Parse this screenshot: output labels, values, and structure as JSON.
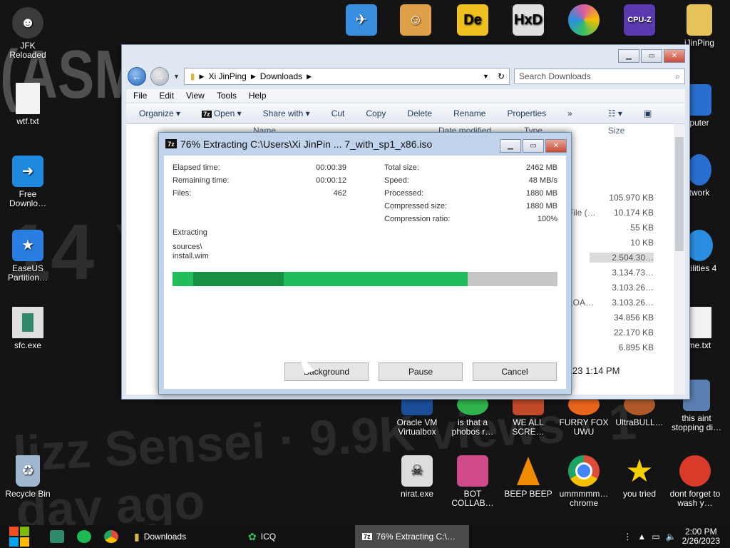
{
  "desktop": {
    "wallpaper_text": [
      "(ASMR)",
      "14 Year",
      "lizz Sensei · 9.9K views · 1 day ago"
    ],
    "icons": [
      {
        "label": "JFK Reloaded",
        "icon": "person-icon",
        "color": "#3b3b3b"
      },
      {
        "label": "wtf.txt",
        "icon": "text-file-icon",
        "color": "#f2f2f2"
      },
      {
        "label": "Free Downlo…",
        "icon": "download-arrow-icon",
        "color": "#1d8ae0"
      },
      {
        "label": "EaseUS Partition…",
        "icon": "easeus-icon",
        "color": "#2a7de1"
      },
      {
        "label": "sfc.exe",
        "icon": "app-window-icon",
        "color": "#e0e0e0"
      },
      {
        "label": "Recycle Bin",
        "icon": "recycle-bin-icon",
        "color": "#9fb8d0"
      },
      {
        "label": "puter",
        "icon": "monitor-icon",
        "color": "#2a6fd0"
      },
      {
        "label": "twork",
        "icon": "network-icon",
        "color": "#2a6fd0"
      },
      {
        "label": "Utilities 4",
        "icon": "utilities-icon",
        "color": "#2a8ee0"
      },
      {
        "label": "me.txt",
        "icon": "text-file-icon",
        "color": "#f2f2f2"
      },
      {
        "label": "this aint stopping di…",
        "icon": "computer-icon",
        "color": "#5a7fb0"
      },
      {
        "label": "iJinPing",
        "icon": "folder-user-icon",
        "color": "#e6c25a"
      },
      {
        "label": "Oracle VM Virtualbox",
        "icon": "virtualbox-icon",
        "color": "#1b4f99"
      },
      {
        "label": "is that a phobos r…",
        "icon": "alien-icon",
        "color": "#2fb34a"
      },
      {
        "label": "WE ALL SCRE…",
        "icon": "app-icon",
        "color": "#c04a2a"
      },
      {
        "label": "FURRY FOX UWU",
        "icon": "firefox-icon",
        "color": "#e8671c"
      },
      {
        "label": "UltraBULL…",
        "icon": "disc-icon",
        "color": "#b05a2a"
      },
      {
        "label": "nirat.exe",
        "icon": "skull-icon",
        "color": "#dddddd"
      },
      {
        "label": "BOT COLLAB…",
        "icon": "monitor-pink-icon",
        "color": "#d04a8a"
      },
      {
        "label": "BEEP BEEP",
        "icon": "vlc-cone-icon",
        "color": "#f08a00"
      },
      {
        "label": "ummmmm… chrome",
        "icon": "chrome-icon",
        "color": "#dd4b39"
      },
      {
        "label": "you tried",
        "icon": "star-icon",
        "color": "#f5d000"
      },
      {
        "label": "dont forget to wash y…",
        "icon": "ccleaner-icon",
        "color": "#d93a2a"
      }
    ],
    "top_icons": [
      {
        "icon": "airplane-app-icon",
        "color": "#3a8ee0"
      },
      {
        "icon": "doctor-app-icon",
        "color": "#e0a04a"
      },
      {
        "icon": "de-app-icon",
        "color": "#f0c020"
      },
      {
        "icon": "hxd-app-icon",
        "color": "#e0e0e0"
      },
      {
        "icon": "pinwheel-app-icon",
        "color": "#e05aa0"
      },
      {
        "icon": "cpuz-app-icon",
        "color": "#5a3ab0"
      }
    ]
  },
  "explorer": {
    "breadcrumb": [
      "Xi JinPing",
      "Downloads"
    ],
    "search_placeholder": "Search Downloads",
    "menu": [
      "File",
      "Edit",
      "View",
      "Tools",
      "Help"
    ],
    "toolbar": [
      "Organize",
      "Open",
      "Share with",
      "Cut",
      "Copy",
      "Delete",
      "Rename",
      "Properties"
    ],
    "columns": {
      "name": "Name",
      "date": "Date modified",
      "type": "Type",
      "size": "Size"
    },
    "sizes": [
      "105.970 KB",
      "10.174 KB",
      "55 KB",
      "10 KB",
      "2.504.30…",
      "3.134.73…",
      "3.103.26…",
      "3.103.26…",
      "34.856 KB",
      "22.170 KB",
      "6.895 KB"
    ],
    "type_fragments": [
      "File (…",
      "LOA…"
    ],
    "status_date": "23 1:14 PM"
  },
  "dialog": {
    "title": "76% Extracting C:\\Users\\Xi JinPin ... 7_with_sp1_x86.iso",
    "app_label": "7z",
    "left_stats": [
      {
        "label": "Elapsed time:",
        "value": "00:00:39"
      },
      {
        "label": "Remaining time:",
        "value": "00:00:12"
      },
      {
        "label": "Files:",
        "value": "462"
      }
    ],
    "right_stats": [
      {
        "label": "Total size:",
        "value": "2462 MB"
      },
      {
        "label": "Speed:",
        "value": "48 MB/s"
      },
      {
        "label": "Processed:",
        "value": "1880 MB"
      },
      {
        "label": "Compressed size:",
        "value": "1880 MB"
      },
      {
        "label": "Compression ratio:",
        "value": "100%"
      }
    ],
    "status": "Extracting",
    "path": "sources\\",
    "file": "install.wim",
    "progress_fraction": 0.766,
    "buttons": {
      "background": "Background",
      "pause": "Pause",
      "cancel": "Cancel"
    }
  },
  "taskbar": {
    "tasks": [
      {
        "label": "Downloads",
        "icon": "folder-icon"
      },
      {
        "label": "ICQ",
        "icon": "icq-flower-icon"
      },
      {
        "label": "76% Extracting C:\\…",
        "icon": "sevenzip-icon"
      }
    ],
    "clock_time": "2:00 PM",
    "clock_date": "2/26/2023"
  },
  "colors": {
    "progress": "#21bd5a",
    "start_red": "#f25022",
    "start_green": "#7fba00",
    "start_blue": "#00a4ef",
    "start_yellow": "#ffb900"
  }
}
